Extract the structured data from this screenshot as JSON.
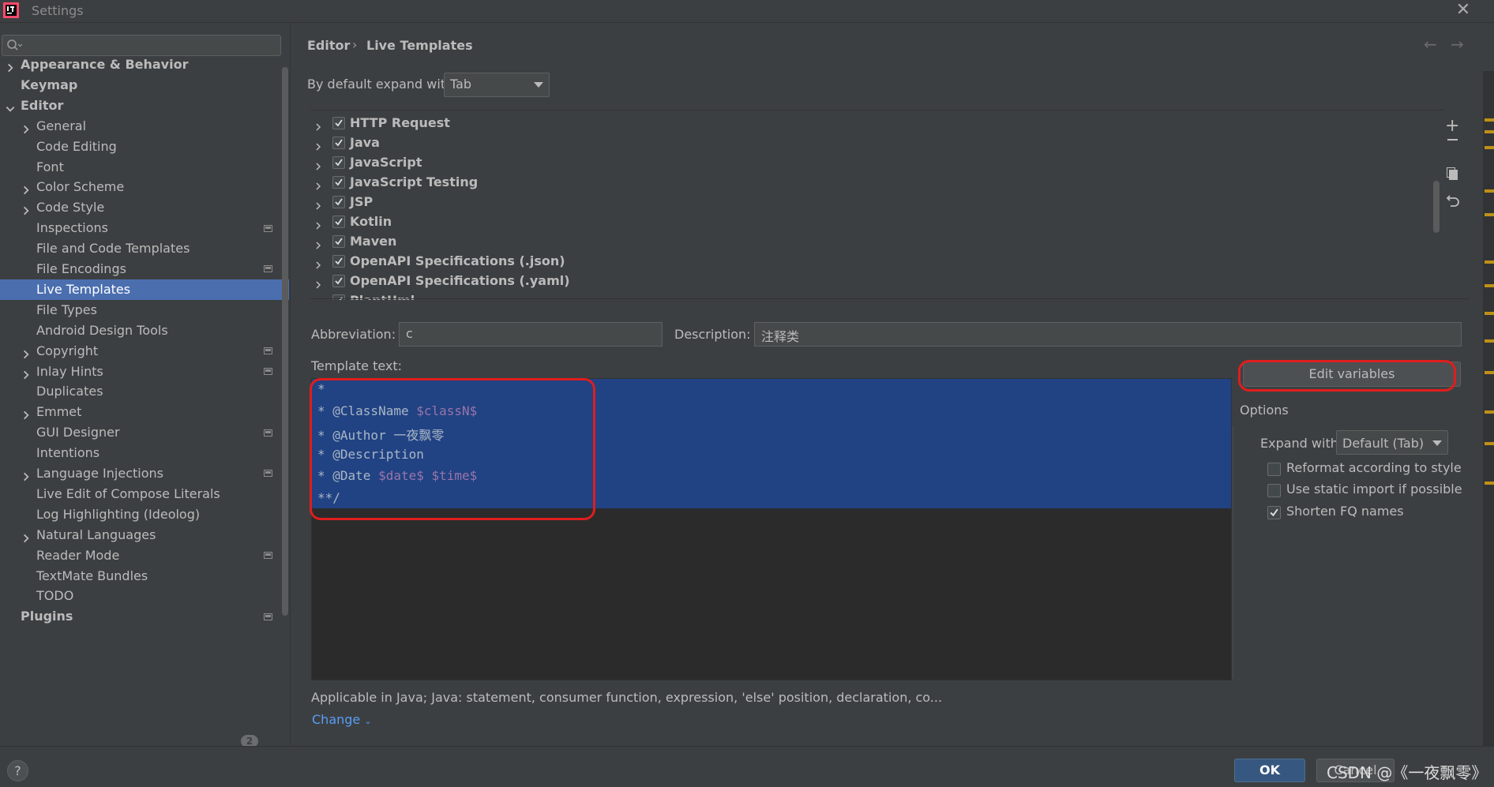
{
  "window": {
    "title": "Settings"
  },
  "sidebar": {
    "items": [
      {
        "label": "Appearance & Behavior",
        "level": 0,
        "bold": true,
        "expandable": true,
        "expanded": false
      },
      {
        "label": "Keymap",
        "level": 0,
        "bold": true
      },
      {
        "label": "Editor",
        "level": 0,
        "bold": true,
        "expandable": true,
        "expanded": true
      },
      {
        "label": "General",
        "level": 1,
        "expandable": true
      },
      {
        "label": "Code Editing",
        "level": 1
      },
      {
        "label": "Font",
        "level": 1
      },
      {
        "label": "Color Scheme",
        "level": 1,
        "expandable": true
      },
      {
        "label": "Code Style",
        "level": 1,
        "expandable": true
      },
      {
        "label": "Inspections",
        "level": 1,
        "project": true
      },
      {
        "label": "File and Code Templates",
        "level": 1
      },
      {
        "label": "File Encodings",
        "level": 1,
        "project": true
      },
      {
        "label": "Live Templates",
        "level": 1,
        "selected": true
      },
      {
        "label": "File Types",
        "level": 1
      },
      {
        "label": "Android Design Tools",
        "level": 1
      },
      {
        "label": "Copyright",
        "level": 1,
        "expandable": true,
        "project": true
      },
      {
        "label": "Inlay Hints",
        "level": 1,
        "expandable": true,
        "project": true
      },
      {
        "label": "Duplicates",
        "level": 1
      },
      {
        "label": "Emmet",
        "level": 1,
        "expandable": true
      },
      {
        "label": "GUI Designer",
        "level": 1,
        "project": true
      },
      {
        "label": "Intentions",
        "level": 1
      },
      {
        "label": "Language Injections",
        "level": 1,
        "expandable": true,
        "project": true
      },
      {
        "label": "Live Edit of Compose Literals",
        "level": 1
      },
      {
        "label": "Log Highlighting (Ideolog)",
        "level": 1
      },
      {
        "label": "Natural Languages",
        "level": 1,
        "expandable": true
      },
      {
        "label": "Reader Mode",
        "level": 1,
        "project": true
      },
      {
        "label": "TextMate Bundles",
        "level": 1
      },
      {
        "label": "TODO",
        "level": 1
      },
      {
        "label": "Plugins",
        "level": 0,
        "bold": true,
        "project": true
      }
    ],
    "plugins_badge": "2"
  },
  "breadcrumb": {
    "parent": "Editor",
    "separator": "›",
    "current": "Live Templates"
  },
  "expand_default": {
    "label": "By default expand with",
    "value": "Tab"
  },
  "groups": [
    {
      "label": "HTTP Request",
      "checked": true
    },
    {
      "label": "Java",
      "checked": true
    },
    {
      "label": "JavaScript",
      "checked": true
    },
    {
      "label": "JavaScript Testing",
      "checked": true
    },
    {
      "label": "JSP",
      "checked": true
    },
    {
      "label": "Kotlin",
      "checked": true
    },
    {
      "label": "Maven",
      "checked": true
    },
    {
      "label": "OpenAPI Specifications (.json)",
      "checked": true
    },
    {
      "label": "OpenAPI Specifications (.yaml)",
      "checked": true
    },
    {
      "label": "PlantUml",
      "checked": true
    }
  ],
  "abbreviation": {
    "label": "Abbreviation:",
    "value": "c"
  },
  "description": {
    "label": "Description:",
    "value": "注释类"
  },
  "template_text": {
    "label": "Template text:",
    "lines": [
      {
        "text": "*"
      },
      {
        "text": "* @ClassName ",
        "var": "$classN$"
      },
      {
        "text": "* @Author 一夜飘零"
      },
      {
        "text": "* @Description"
      },
      {
        "text": "* @Date ",
        "var": "$date$ $time$"
      },
      {
        "text": "**/"
      }
    ]
  },
  "edit_variables_label": "Edit variables",
  "options": {
    "title": "Options",
    "expand_with_label": "Expand with",
    "expand_with_value": "Default (Tab)",
    "checkboxes": [
      {
        "label": "Reformat according to style",
        "checked": false
      },
      {
        "label": "Use static import if possible",
        "checked": false
      },
      {
        "label": "Shorten FQ names",
        "checked": true
      }
    ]
  },
  "applicable_text": "Applicable in Java; Java: statement, consumer function, expression, 'else' position, declaration, co...",
  "change_link": "Change",
  "footer": {
    "help": "?",
    "ok": "OK",
    "cancel": "Cancel",
    "watermark": "CSDN @《一夜飘零》"
  },
  "colors": {
    "selection": "#4b6eaf",
    "editor_selection": "#214283",
    "annotation_red": "#e01d1d",
    "variable": "#9876aa",
    "link": "#589df6"
  }
}
